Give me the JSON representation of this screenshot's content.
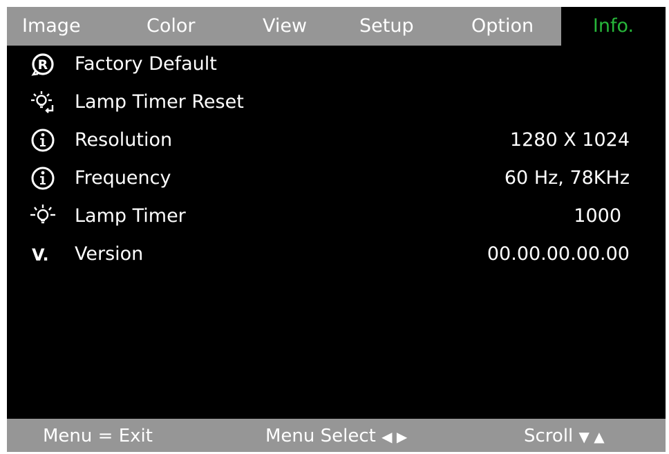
{
  "tabs": [
    {
      "label": "Image"
    },
    {
      "label": "Color"
    },
    {
      "label": "View"
    },
    {
      "label": "Setup"
    },
    {
      "label": "Option"
    },
    {
      "label": "Info."
    }
  ],
  "active_tab_color": "#27b63a",
  "bar_color": "#969696",
  "rows": [
    {
      "icon": "factory-reset-icon",
      "label": "Factory Default",
      "value": ""
    },
    {
      "icon": "lamp-reset-icon",
      "label": "Lamp Timer Reset",
      "value": ""
    },
    {
      "icon": "info-icon",
      "label": "Resolution",
      "value": "1280 X 1024"
    },
    {
      "icon": "info-icon",
      "label": "Frequency",
      "value": "60 Hz, 78KHz"
    },
    {
      "icon": "lamp-icon",
      "label": "Lamp Timer",
      "value": "1000"
    },
    {
      "icon": "version-icon",
      "label": "Version",
      "value": "00.00.00.00.00"
    }
  ],
  "footer": {
    "exit": "Menu = Exit",
    "select": "Menu Select",
    "select_arrows": "◀ ▶",
    "scroll": "Scroll",
    "scroll_arrows": "▼ ▲"
  }
}
